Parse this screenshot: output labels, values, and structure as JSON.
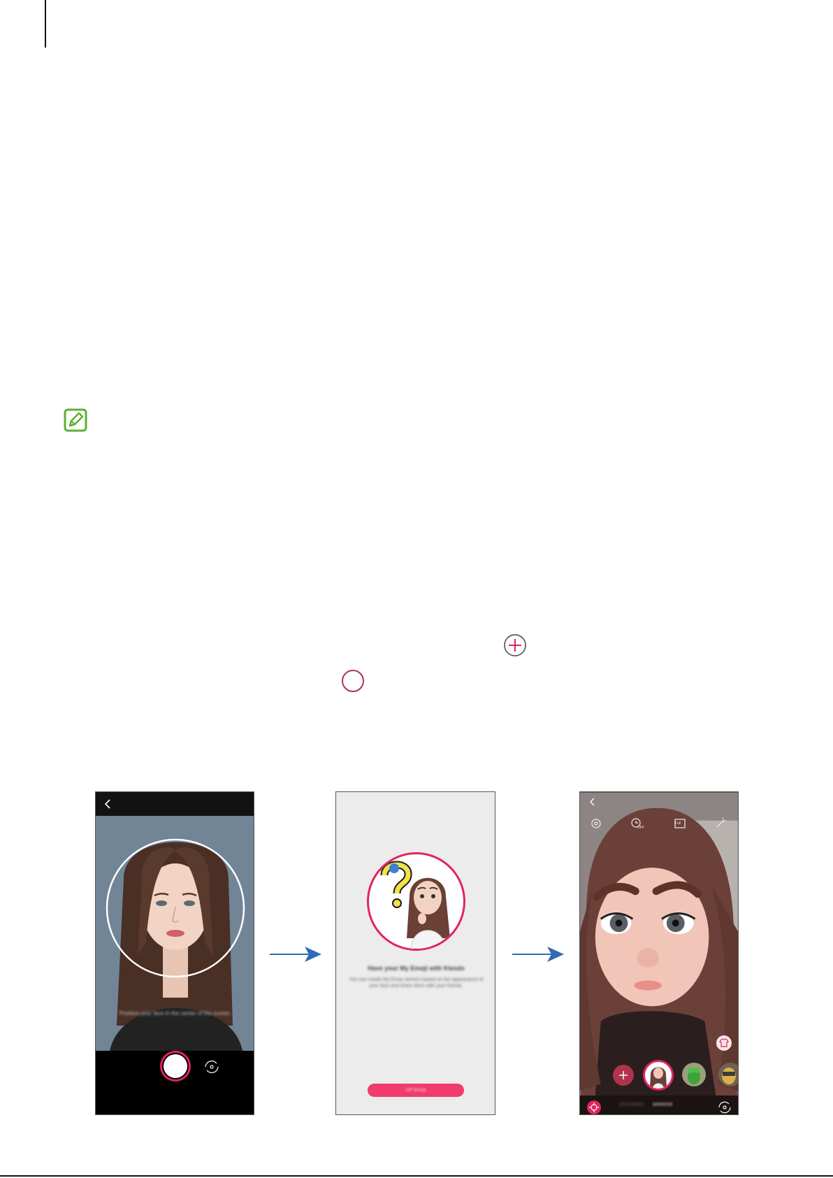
{
  "page": {
    "accent_color": "#e0245e",
    "note_icon_color": "#5bb030",
    "arrow_color": "#2f6cb3"
  },
  "icons": {
    "note": "note-pencil-icon",
    "add": "plus-circle-icon",
    "record": "record-circle-icon"
  },
  "phone_camera": {
    "back_icon": "back-arrow-icon",
    "hint_text": "Position your face in the center of the screen.",
    "shutter_icon": "shutter-button-icon",
    "switch_icon": "switch-camera-icon"
  },
  "phone_intro": {
    "title": "Have your My Emoji with friends",
    "description": "You can create My Emoji stickers based on the appearance of your face and share them with your friends.",
    "button_label": "UP Emoji"
  },
  "phone_emoji": {
    "back_icon": "back-arrow-icon",
    "top_icons": [
      "settings-icon",
      "timer-off-icon",
      "full-ratio-icon",
      "effects-icon"
    ],
    "timer_label": "OFF",
    "ratio_label": "Full",
    "tabs": [
      "STICKERS",
      "MIRROR"
    ],
    "add_icon": "plus-icon",
    "shirt_icon": "shirt-icon",
    "sticker_icon": "sticker-icon",
    "switch_icon": "switch-camera-icon"
  }
}
